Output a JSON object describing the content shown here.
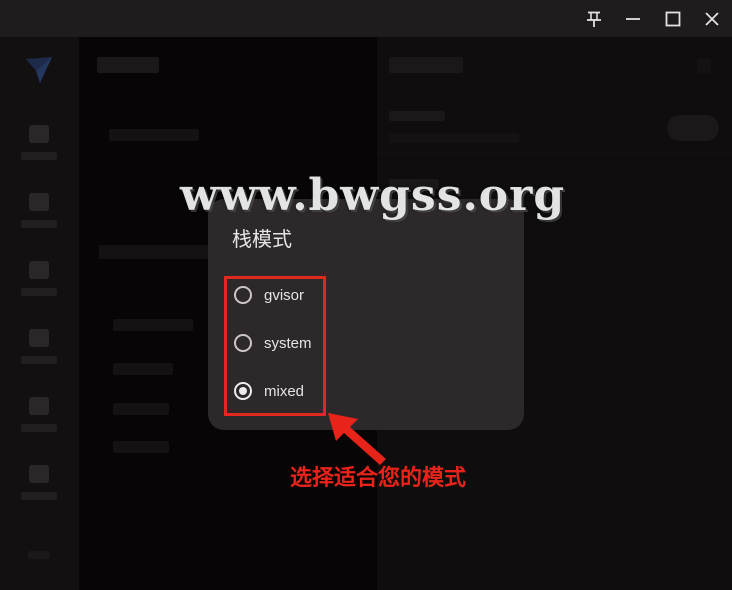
{
  "watermark": "www.bwgss.org",
  "dialog": {
    "title": "栈模式",
    "options": [
      {
        "label": "gvisor",
        "selected": false
      },
      {
        "label": "system",
        "selected": false
      },
      {
        "label": "mixed",
        "selected": true
      }
    ]
  },
  "annotation": {
    "text": "选择适合您的模式",
    "color": "#e8231a"
  },
  "colors": {
    "dialog_bg": "#2d292a",
    "titlebar_bg": "#1f1c1d",
    "highlight": "#e0281e"
  },
  "icons": {
    "titlebar": [
      "pin-icon",
      "minimize-icon",
      "maximize-icon",
      "close-icon"
    ]
  }
}
